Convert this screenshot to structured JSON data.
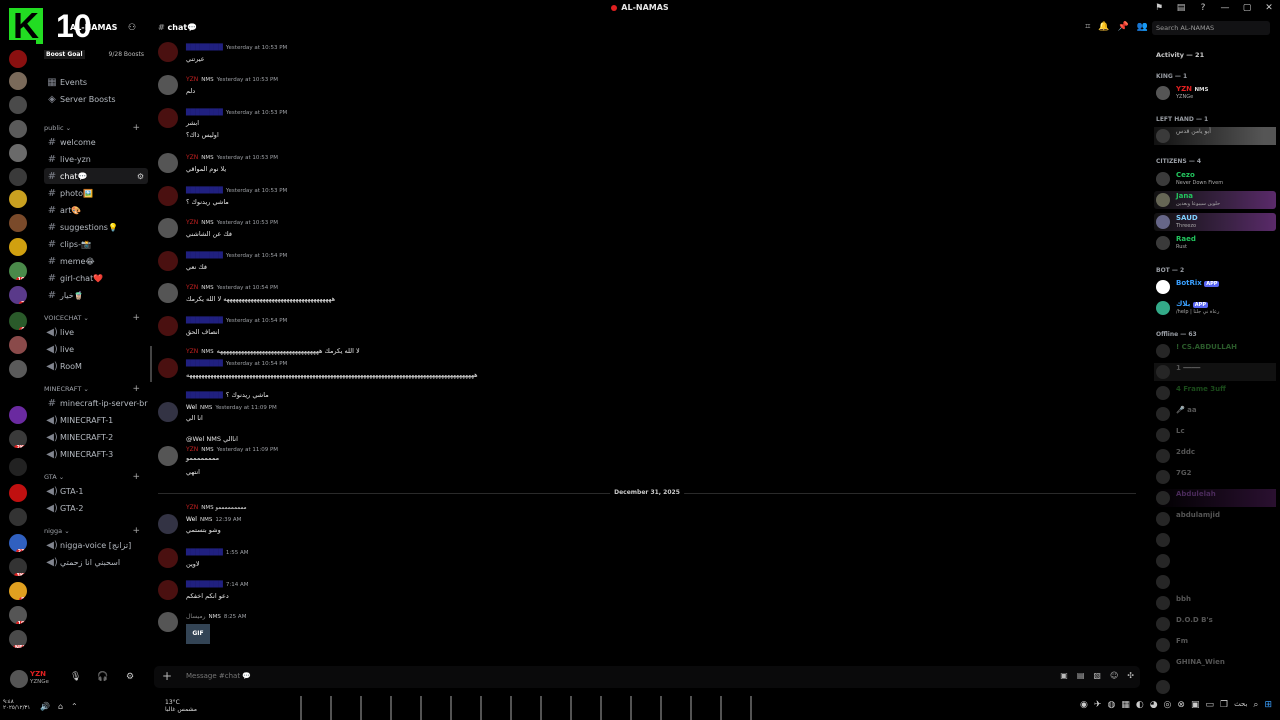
{
  "window": {
    "title": "AL-NAMAS"
  },
  "logo": {
    "letter": "K",
    "number": "10"
  },
  "server": {
    "name": "AL-NAMAS",
    "boost_label": "Boost Goal",
    "boost_count": "9/28 Boosts"
  },
  "nav": {
    "events": "Events",
    "server_boosts": "Server Boosts"
  },
  "categories": {
    "public": "public",
    "voicechat": "VOICECHAT",
    "minecraft": "MINECRAFT",
    "gta": "GTA",
    "nigga": "nigga"
  },
  "channels": {
    "welcome": "welcome",
    "live_yzn": "live-yzn",
    "chat": "chat💬",
    "photo": "photo🖼️",
    "art": "art🎨",
    "suggestions": "suggestions💡",
    "clips": "clips-📸",
    "meme": "meme😂",
    "girl_chat": "girl-chat❤️",
    "arabic": "خيار🧋",
    "live1": "live",
    "live2": "live",
    "room": "RooM",
    "mc_ip": "minecraft-ip-server-br",
    "mc1": "MINECRAFT-1",
    "mc2": "MINECRAFT-2",
    "mc3": "MINECRAFT-3",
    "gta1": "GTA-1",
    "gta2": "GTA-2",
    "voice_nigga": "nigga-voice [تزانج]",
    "voice_ar": "اسحبني انا زحمتي"
  },
  "header": {
    "channel": "chat💬"
  },
  "search": {
    "placeholder": "Search AL-NAMAS"
  },
  "messages": [
    {
      "tag": "",
      "time": "Yesterday at 10:53 PM",
      "text": "عيرتني"
    },
    {
      "tag": "NMS",
      "time": "Yesterday at 10:53 PM",
      "text": "دلم"
    },
    {
      "tag": "",
      "time": "Yesterday at 10:53 PM",
      "text": "ابشر"
    },
    {
      "tag": "",
      "time": "",
      "text": "اوليس ذاك؟"
    },
    {
      "tag": "NMS",
      "time": "Yesterday at 10:53 PM",
      "text": "يلا نوم المواقي"
    },
    {
      "tag": "",
      "time": "Yesterday at 10:53 PM",
      "text": "ماشي ريدنوك ؟"
    },
    {
      "tag": "NMS",
      "time": "Yesterday at 10:53 PM",
      "text": "فك عن الشاشني"
    },
    {
      "tag": "",
      "time": "Yesterday at 10:54 PM",
      "text": "فك نعي"
    },
    {
      "tag": "NMS",
      "time": "Yesterday at 10:54 PM",
      "text": "ههههههههههههههههههههههههههههههههههههه لا الله يكرمك"
    },
    {
      "tag": "",
      "time": "Yesterday at 10:54 PM",
      "text": "انصاف الحق"
    },
    {
      "tag": "NMS",
      "time": "",
      "text": "لا الله يكرمك ههههههههههههههههههههههههههههههههههه"
    },
    {
      "tag": "",
      "time": "Yesterday at 10:54 PM",
      "text": "ههههههههههههههههههههههههههههههههههههههههههههههههههههههههههههههههههههههههههههههههههههههههههههههههه"
    },
    {
      "tag": "",
      "time": "",
      "text": "ماشي ريدنوك ؟"
    },
    {
      "user": "Wel",
      "tag": "NMS",
      "time": "Yesterday at 11:09 PM",
      "text": "انا الي"
    },
    {
      "tag": "",
      "time": "",
      "text": "@Wel NMS اناالي"
    },
    {
      "tag": "NMS",
      "time": "Yesterday at 11:09 PM",
      "text": "ممممممممو"
    },
    {
      "tag": "",
      "time": "",
      "text": "انتهي"
    },
    {
      "tag": "",
      "time": "",
      "text": "NMS مممممممممو"
    },
    {
      "user": "Wel",
      "tag": "NMS",
      "time": "12:39 AM",
      "text": "وشو بتستمي"
    },
    {
      "tag": "",
      "time": "1:55 AM",
      "text": "لاوين"
    },
    {
      "tag": "",
      "time": "7:14 AM",
      "text": "دعو انكم اخفكم"
    },
    {
      "user": "رميسال",
      "tag": "NMS",
      "time": "8:25 AM",
      "text": "GIF"
    }
  ],
  "date_separator": "December 31, 2025",
  "composer": {
    "placeholder": "Message #chat 💬"
  },
  "members": {
    "activity": "Activity — 21",
    "king": "KING — 1",
    "king_user": "YZN",
    "king_tag": "NMS",
    "king_status": "YZNGe",
    "left_hand": "LEFT HAND — 1",
    "left_user": "أبو يامن قدس",
    "citizens": "CITIZENS — 4",
    "c1": "Cezo",
    "c1s": "Never Down Fivem",
    "c2": "Jana",
    "c2s": "حلوين سيبوعا وبعدين",
    "c3": "SAUD",
    "c3s": "Threezo",
    "c4": "Raed",
    "c4s": "Rust",
    "bot": "BOT — 2",
    "b1": "BotRix",
    "b1tag": "APP",
    "b2": "بلاك",
    "b2tag": "APP",
    "b2s": "/help | رعاة ني جلتا",
    "offline": "Offline — 63",
    "o1": "! CS.ABDULLAH",
    "o2": "1 ━━━━",
    "o3": "4 Frame 3uff",
    "o4": "🎤 aa",
    "o5": "Lc",
    "o6": "2ddc",
    "o7": "7G2",
    "o8": "Abdulelah",
    "o9": "abdulamjid",
    "o10": "",
    "o11": "",
    "o12": "",
    "o13": "bbh",
    "o14": "D.O.D B's",
    "o15": "Fm",
    "o16": "GHINA_Wien",
    "o17": ""
  },
  "user": {
    "name": "YZN",
    "status": "YZNGe"
  },
  "taskbar": {
    "weather": "13°C",
    "weather_desc": "مشمس غالبا",
    "time": "٩:٤٨",
    "date": "٢٠٢٥/١٢/٣١",
    "search": "بحث"
  }
}
